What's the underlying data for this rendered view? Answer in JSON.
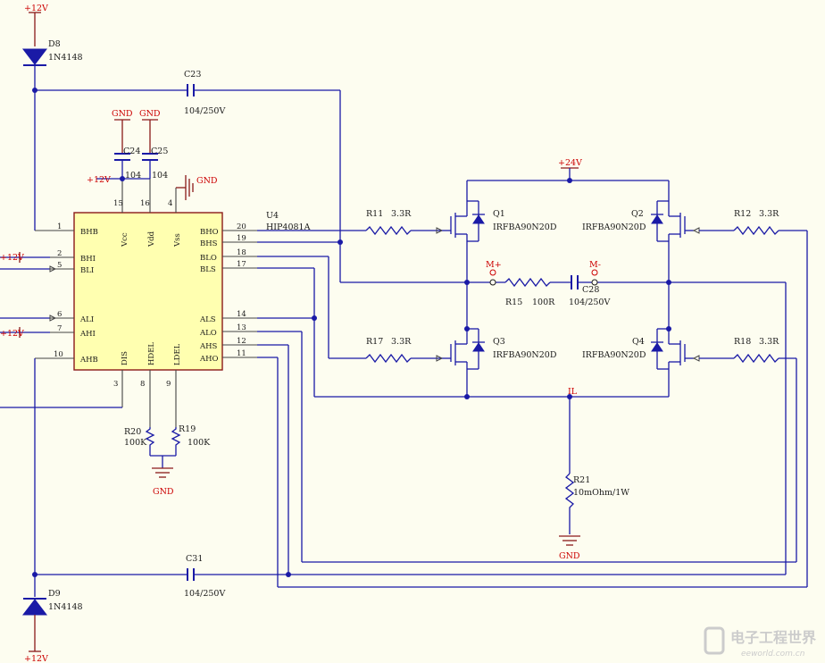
{
  "power": {
    "p12v": "+12V",
    "p24v": "+24V",
    "gnd": "GND"
  },
  "diodes": {
    "d8": {
      "ref": "D8",
      "value": "1N4148"
    },
    "d9": {
      "ref": "D9",
      "value": "1N4148"
    }
  },
  "caps": {
    "c23": {
      "ref": "C23",
      "value": "104/250V"
    },
    "c24": {
      "ref": "C24",
      "value": "104"
    },
    "c25": {
      "ref": "C25",
      "value": "104"
    },
    "c28": {
      "ref": "C28",
      "value": "104/250V"
    },
    "c31": {
      "ref": "C31",
      "value": "104/250V"
    }
  },
  "ic": {
    "ref": "U4",
    "value": "HIP4081A",
    "left_pins": [
      {
        "num": "1",
        "name": "BHB"
      },
      {
        "num": "2",
        "name": "BHI"
      },
      {
        "num": "5",
        "name": "BLI"
      },
      {
        "num": "6",
        "name": "ALI"
      },
      {
        "num": "7",
        "name": "AHI"
      },
      {
        "num": "10",
        "name": "AHB"
      }
    ],
    "right_pins": [
      {
        "num": "20",
        "name": "BHO"
      },
      {
        "num": "19",
        "name": "BHS"
      },
      {
        "num": "18",
        "name": "BLO"
      },
      {
        "num": "17",
        "name": "BLS"
      },
      {
        "num": "14",
        "name": "ALS"
      },
      {
        "num": "13",
        "name": "ALO"
      },
      {
        "num": "12",
        "name": "AHS"
      },
      {
        "num": "11",
        "name": "AHO"
      }
    ],
    "top_pins": [
      {
        "num": "15",
        "name": "Vcc"
      },
      {
        "num": "16",
        "name": "Vdd"
      },
      {
        "num": "4",
        "name": "Vss"
      }
    ],
    "bottom_pins": [
      {
        "num": "3",
        "name": "DIS"
      },
      {
        "num": "8",
        "name": "HDEL"
      },
      {
        "num": "9",
        "name": "LDEL"
      }
    ]
  },
  "resistors": {
    "r11": {
      "ref": "R11",
      "value": "3.3R"
    },
    "r12": {
      "ref": "R12",
      "value": "3.3R"
    },
    "r15": {
      "ref": "R15",
      "value": "100R"
    },
    "r17": {
      "ref": "R17",
      "value": "3.3R"
    },
    "r18": {
      "ref": "R18",
      "value": "3.3R"
    },
    "r19": {
      "ref": "R19",
      "value": "100K"
    },
    "r20": {
      "ref": "R20",
      "value": "100K"
    },
    "r21": {
      "ref": "R21",
      "value": "10mOhm/1W"
    }
  },
  "mosfets": {
    "q1": {
      "ref": "Q1",
      "value": "IRFBA90N20D"
    },
    "q2": {
      "ref": "Q2",
      "value": "IRFBA90N20D"
    },
    "q3": {
      "ref": "Q3",
      "value": "IRFBA90N20D"
    },
    "q4": {
      "ref": "Q4",
      "value": "IRFBA90N20D"
    }
  },
  "nets": {
    "m_plus": "M+",
    "m_minus": "M-",
    "il": "IL"
  },
  "watermark": {
    "text": "电子工程世界",
    "url": "eeworld.com.cn"
  }
}
